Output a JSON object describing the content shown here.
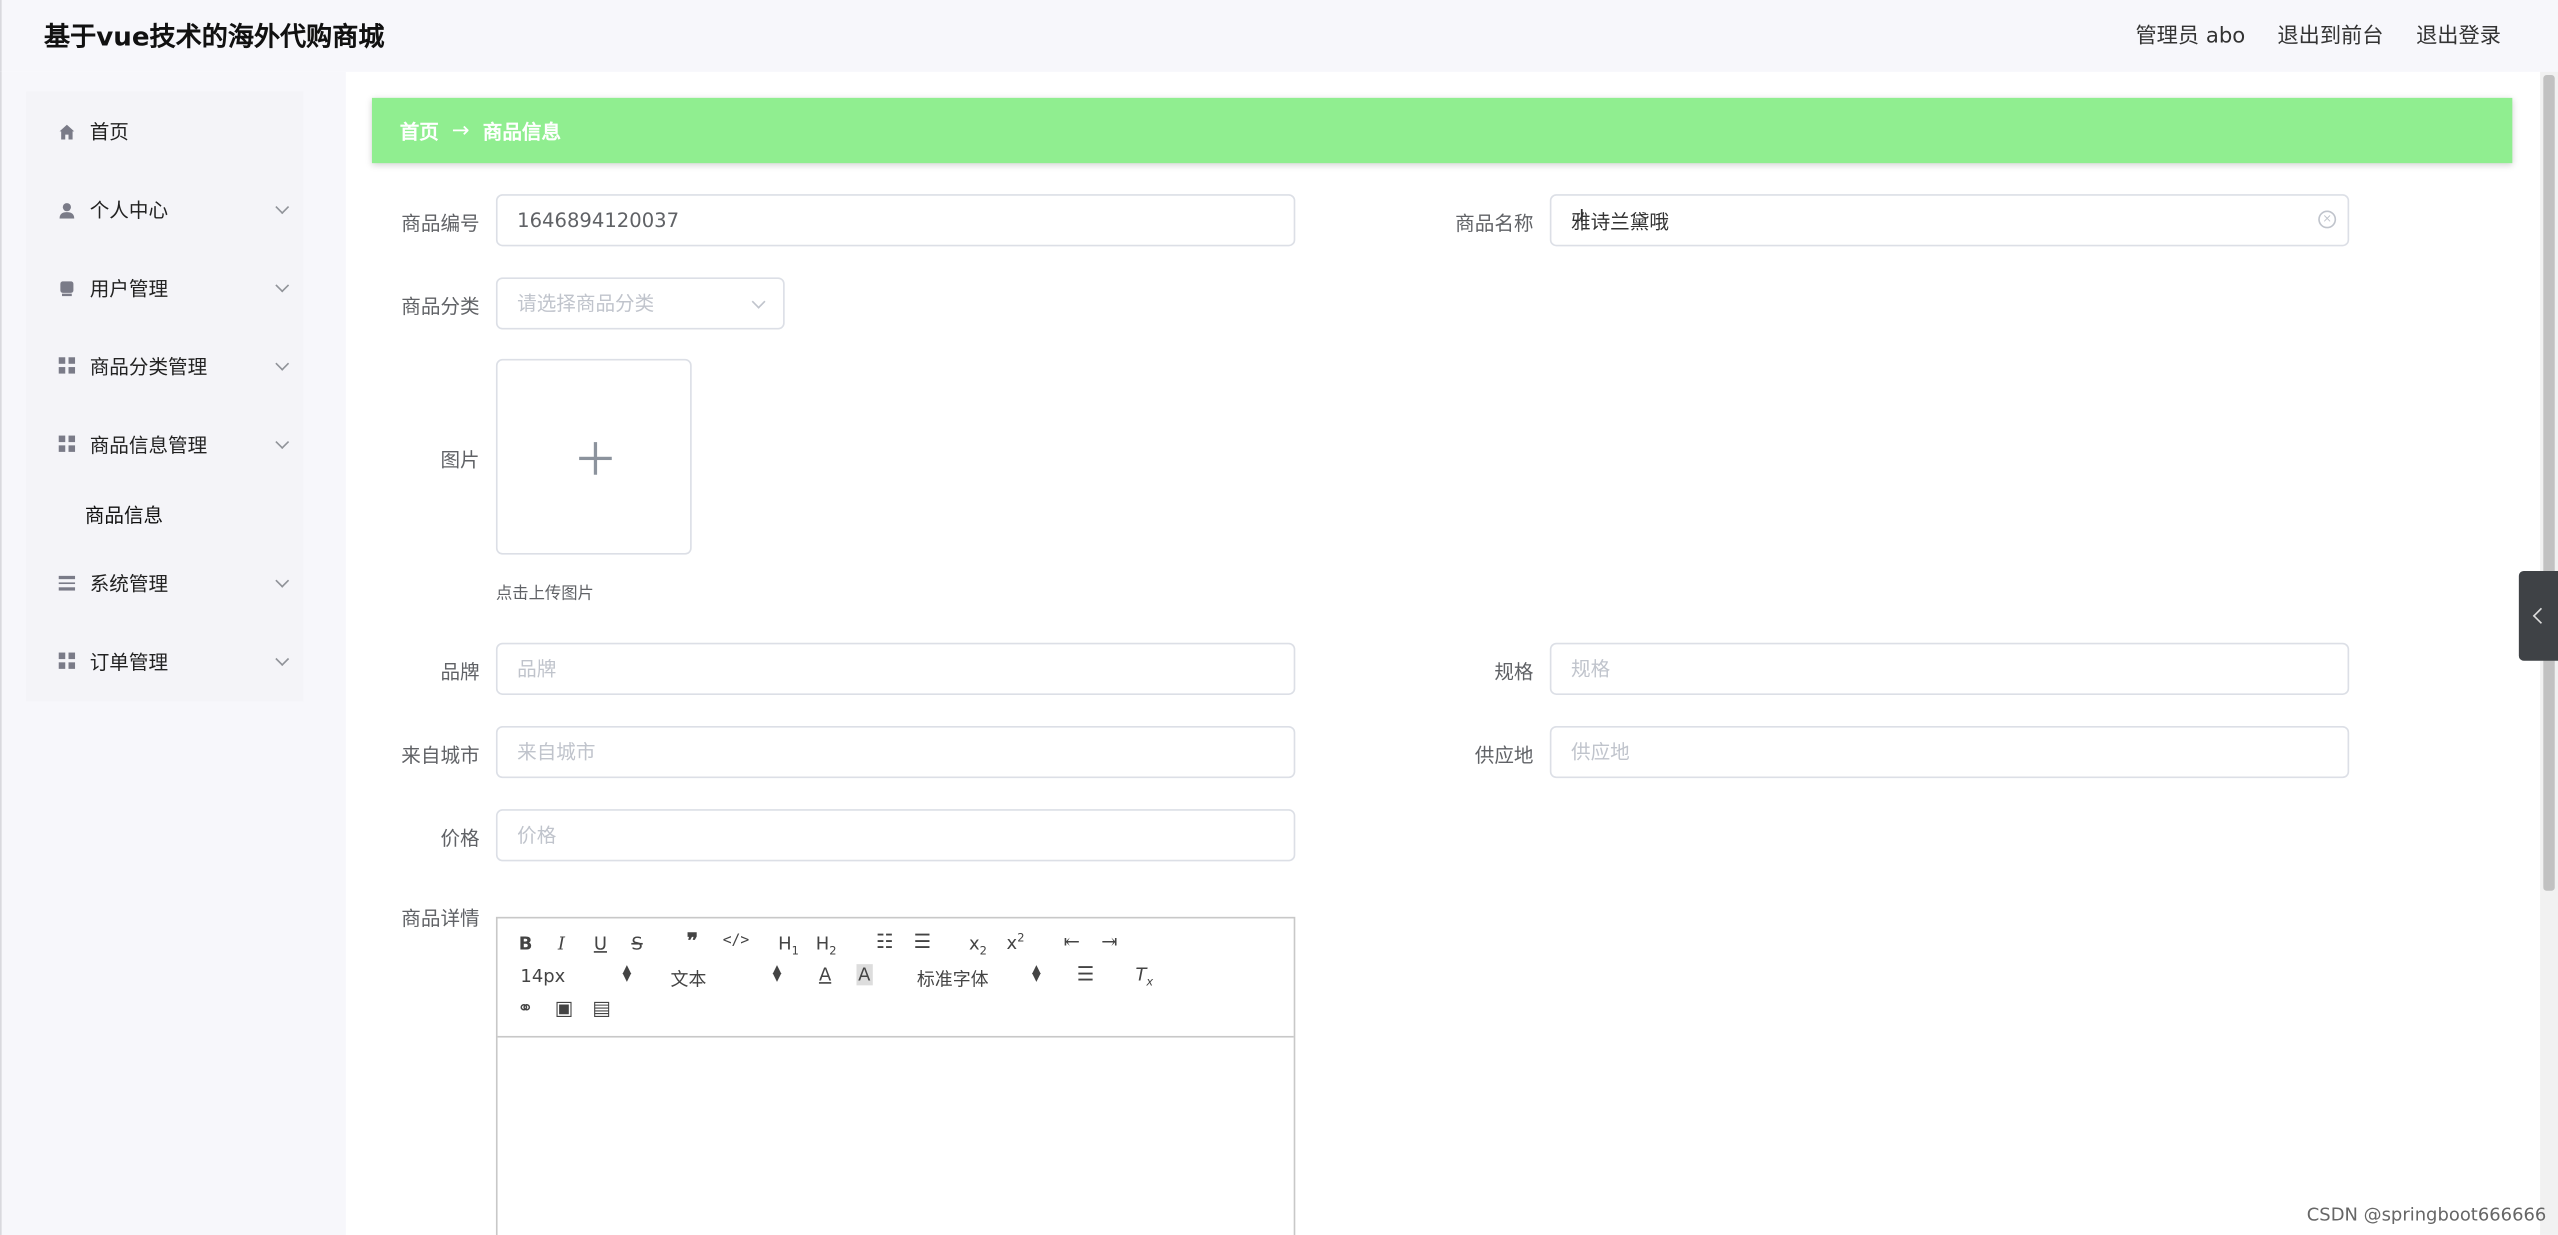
{
  "header": {
    "title": "基于vue技术的海外代购商城",
    "admin_label": "管理员 abo",
    "front_label": "退出到前台",
    "logout_label": "退出登录"
  },
  "sidebar": {
    "items": [
      {
        "label": "首页",
        "icon": "home-icon"
      },
      {
        "label": "个人中心",
        "icon": "user-icon"
      },
      {
        "label": "用户管理",
        "icon": "users-icon"
      },
      {
        "label": "商品分类管理",
        "icon": "grid-icon"
      },
      {
        "label": "商品信息管理",
        "icon": "grid-icon"
      },
      {
        "label": "系统管理",
        "icon": "list-icon"
      },
      {
        "label": "订单管理",
        "icon": "grid-icon"
      }
    ],
    "sub_item": "商品信息"
  },
  "breadcrumb": {
    "home": "首页",
    "separator": "→",
    "current": "商品信息"
  },
  "form": {
    "code_label": "商品编号",
    "code_value": "1646894120037",
    "name_label": "商品名称",
    "name_value": "雅诗兰黛哦",
    "category_label": "商品分类",
    "category_placeholder": "请选择商品分类",
    "image_label": "图片",
    "upload_hint": "点击上传图片",
    "brand_label": "品牌",
    "brand_placeholder": "品牌",
    "spec_label": "规格",
    "spec_placeholder": "规格",
    "city_label": "来自城市",
    "city_placeholder": "来自城市",
    "supply_label": "供应地",
    "supply_placeholder": "供应地",
    "price_label": "价格",
    "price_placeholder": "价格",
    "detail_label": "商品详情"
  },
  "editor": {
    "font_size": "14px",
    "header_select": "文本",
    "font_family": "标准字体"
  },
  "watermark": "CSDN @springboot666666",
  "colors": {
    "breadcrumb_bg": "#90ee90",
    "sidebar_bg": "#f4f4f8"
  }
}
